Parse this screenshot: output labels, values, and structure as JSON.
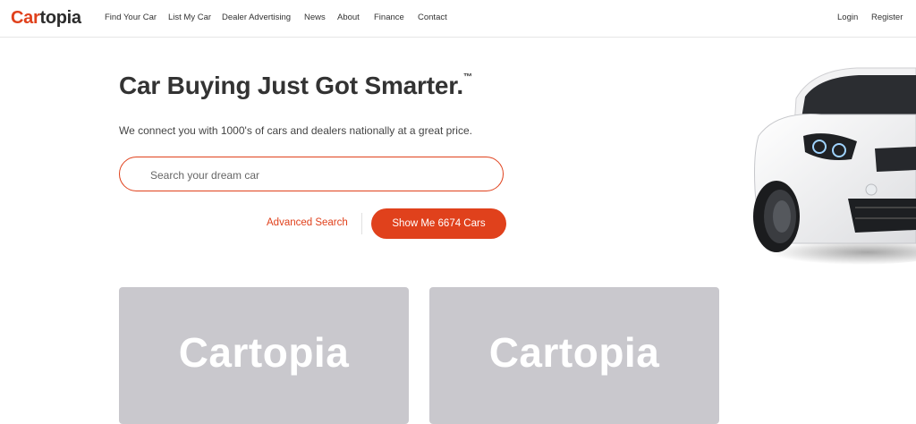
{
  "brand": {
    "part1": "Car",
    "part2": "topia"
  },
  "nav": {
    "items": [
      "Find Your Car",
      "List My Car",
      "Dealer Advertising",
      "News",
      "About",
      "Finance",
      "Contact"
    ],
    "login": "Login",
    "register": "Register"
  },
  "hero": {
    "title": "Car Buying Just Got Smarter.",
    "trademark": "™",
    "subtitle": "We connect you with 1000's of cars and dealers nationally at a great price.",
    "search_placeholder": "Search your dream car",
    "advanced_search": "Advanced Search",
    "cta": "Show Me 6674 Cars"
  },
  "cards": [
    {
      "watermark": "Cartopia"
    },
    {
      "watermark": "Cartopia"
    }
  ],
  "colors": {
    "accent": "#e0411c",
    "card_bg": "#c9c8cd"
  }
}
